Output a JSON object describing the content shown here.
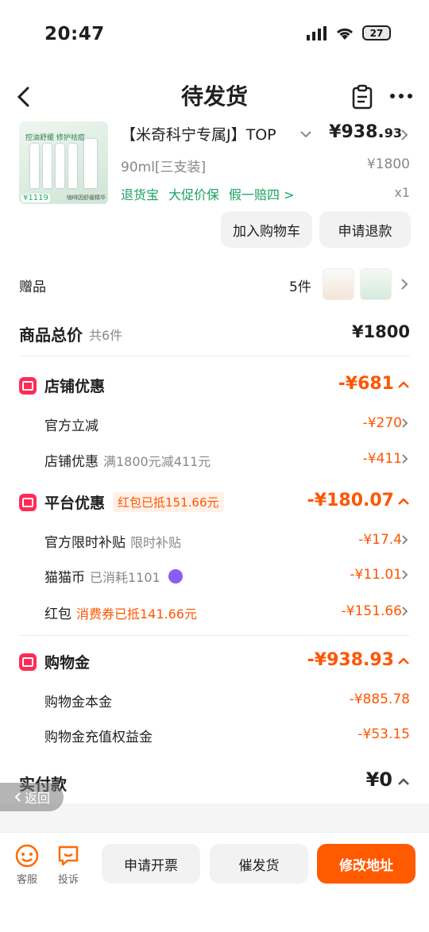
{
  "status_bar": {
    "time": "20:47",
    "battery": "27"
  },
  "nav": {
    "title": "待发货"
  },
  "product": {
    "title": "【米奇科宁专属J】TOP",
    "price_int": "¥938.",
    "price_dec": "93",
    "spec": "90ml[三支装]",
    "original_price": "¥1800",
    "services": [
      "退货宝",
      "大促价保",
      "假一赔四 >"
    ],
    "qty": "x1",
    "thumb_tagline": "控油舒缓 修护祛痘",
    "thumb_price": "¥1119",
    "thumb_desc": "咖啡因舒缓精华",
    "add_cart": "加入购物车",
    "refund": "申请退款"
  },
  "gift": {
    "label": "赠品",
    "count": "5件"
  },
  "total": {
    "label": "商品总价",
    "count": "共6件",
    "amount": "¥1800"
  },
  "store_discount": {
    "title": "店铺优惠",
    "amount": "-¥681",
    "items": [
      {
        "label": "官方立减",
        "note": "",
        "amount": "-¥270"
      },
      {
        "label": "店铺优惠",
        "note": "满1800元减411元",
        "amount": "-¥411"
      }
    ]
  },
  "platform_discount": {
    "title": "平台优惠",
    "tag": "红包已抵151.66元",
    "amount": "-¥180.07",
    "items": [
      {
        "label": "官方限时补贴",
        "note": "限时补贴",
        "amount": "-¥17.4"
      },
      {
        "label": "猫猫币",
        "note": "已消耗1101",
        "amount": "-¥11.01"
      },
      {
        "label": "红包",
        "note": "消费券已抵141.66元",
        "amount": "-¥151.66"
      }
    ]
  },
  "shopping_gold": {
    "title": "购物金",
    "amount": "-¥938.93",
    "items": [
      {
        "label": "购物金本金",
        "amount": "-¥885.78"
      },
      {
        "label": "购物金充值权益金",
        "amount": "-¥53.15"
      }
    ]
  },
  "paid": {
    "label": "实付款",
    "amount": "¥0"
  },
  "float_back": "返回",
  "bottom_bar": {
    "service": "客服",
    "complain": "投诉",
    "invoice": "申请开票",
    "urge": "催发货",
    "modify": "修改地址"
  },
  "colors": {
    "accent": "#ff5500",
    "green": "#1aa260",
    "red_icon": "#ff2b55"
  }
}
